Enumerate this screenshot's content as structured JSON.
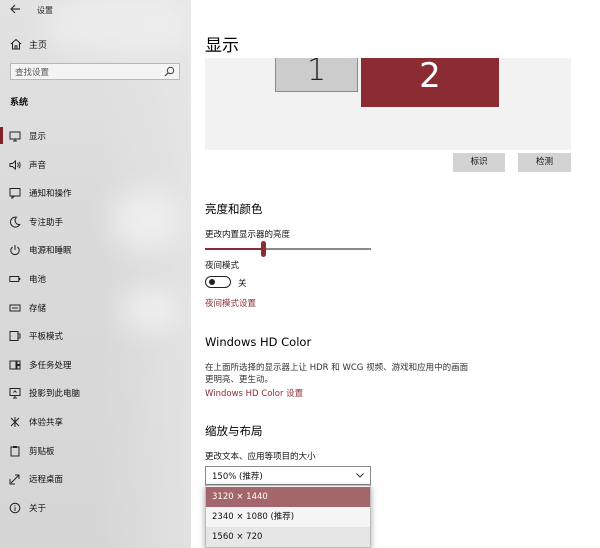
{
  "window": {
    "title": "设置"
  },
  "sidebar": {
    "home_label": "主页",
    "search_placeholder": "查找设置",
    "section_title": "系统",
    "items": [
      {
        "label": "显示",
        "icon": "display-icon",
        "active": true
      },
      {
        "label": "声音",
        "icon": "speaker-icon"
      },
      {
        "label": "通知和操作",
        "icon": "notification-icon"
      },
      {
        "label": "专注助手",
        "icon": "moon-icon"
      },
      {
        "label": "电源和睡眠",
        "icon": "power-icon"
      },
      {
        "label": "电池",
        "icon": "battery-icon"
      },
      {
        "label": "存储",
        "icon": "storage-icon"
      },
      {
        "label": "平板模式",
        "icon": "tablet-icon"
      },
      {
        "label": "多任务处理",
        "icon": "multitask-icon"
      },
      {
        "label": "投影到此电脑",
        "icon": "project-icon"
      },
      {
        "label": "体验共享",
        "icon": "share-icon"
      },
      {
        "label": "剪贴板",
        "icon": "clipboard-icon"
      },
      {
        "label": "远程桌面",
        "icon": "remote-desktop-icon"
      },
      {
        "label": "关于",
        "icon": "info-icon"
      }
    ]
  },
  "main": {
    "title": "显示",
    "monitors": [
      {
        "label": "1"
      },
      {
        "label": "2",
        "selected": true
      }
    ],
    "identify_label": "标识",
    "detect_label": "检测",
    "brightness_section": "亮度和颜色",
    "brightness_label": "更改内置显示器的亮度",
    "brightness_value": 0.35,
    "night_mode_label": "夜间模式",
    "night_mode_state": "关",
    "night_mode_link": "夜间模式设置",
    "hd_color_title": "Windows HD Color",
    "hd_color_desc": "在上面所选择的显示器上让 HDR 和 WCG 视频、游戏和应用中的画面更明亮、更生动。",
    "hd_color_link": "Windows HD Color 设置",
    "scale_section": "缩放与布局",
    "scale_label": "更改文本、应用等项目的大小",
    "scale_value": "150% (推荐)",
    "resolution_options": [
      "3120 × 1440",
      "2340 × 1080 (推荐)",
      "1560 × 720"
    ],
    "resolution_selected_index": 0
  },
  "colors": {
    "accent": "#8b2c33",
    "selected_option": "#a3676b"
  }
}
